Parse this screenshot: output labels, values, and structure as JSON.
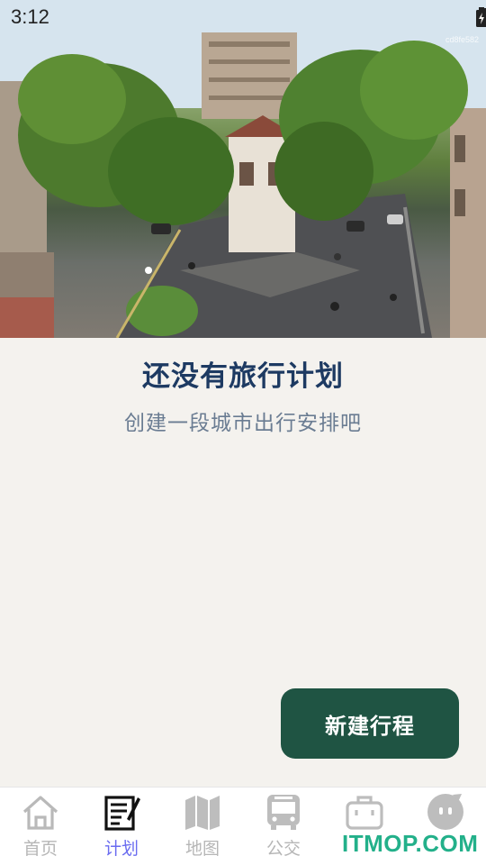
{
  "status_bar": {
    "time": "3:12",
    "wifi_icon": "wifi-icon",
    "signal_icon": "signal-icon",
    "battery_icon": "battery-charging-icon"
  },
  "hero": {
    "tag": "cd8fe582"
  },
  "empty_state": {
    "title": "还没有旅行计划",
    "subtitle": "创建一段城市出行安排吧"
  },
  "actions": {
    "new_trip_label": "新建行程"
  },
  "tabbar": {
    "items": [
      {
        "label": "首页",
        "icon": "home-icon",
        "active": false
      },
      {
        "label": "计划",
        "icon": "plan-icon",
        "active": true
      },
      {
        "label": "地图",
        "icon": "map-icon",
        "active": false
      },
      {
        "label": "公交",
        "icon": "bus-icon",
        "active": false
      },
      {
        "label": "",
        "icon": "luggage-icon",
        "active": false
      },
      {
        "label": "",
        "icon": "profile-icon",
        "active": false
      }
    ]
  },
  "watermark": "ITMOP.COM",
  "colors": {
    "accent": "#1f5443",
    "active_tab": "#6a6cf0",
    "title": "#1d3a62",
    "subtitle": "#6a7c92",
    "background": "#f4f2ee"
  }
}
